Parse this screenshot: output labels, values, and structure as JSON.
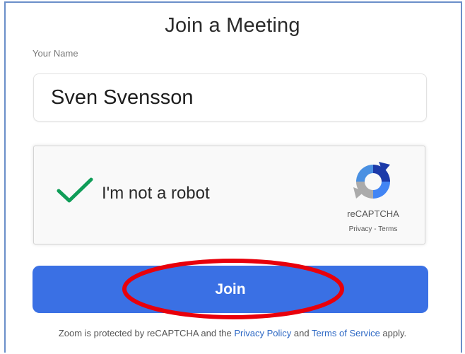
{
  "page": {
    "title": "Join a Meeting"
  },
  "name_field": {
    "label": "Your Name",
    "value": "Sven Svensson"
  },
  "captcha": {
    "checked": true,
    "label": "I'm not a robot",
    "brand": "reCAPTCHA",
    "privacy_link": "Privacy",
    "separator": " - ",
    "terms_link": "Terms",
    "logo_icon": "recaptcha-logo-icon",
    "check_icon": "green-checkmark-icon"
  },
  "join_button": {
    "label": "Join"
  },
  "annotation": {
    "shape": "ellipse",
    "color": "#e8000b",
    "target": "join-button"
  },
  "footer": {
    "prefix": "Zoom is protected by reCAPTCHA and the ",
    "privacy_link": "Privacy Policy",
    "middle": " and ",
    "terms_link": "Terms of Service",
    "suffix": " apply."
  },
  "colors": {
    "accent": "#3a70e4",
    "frame_border": "#6b8fc9",
    "link": "#2d68c4",
    "check": "#0f9d58"
  }
}
